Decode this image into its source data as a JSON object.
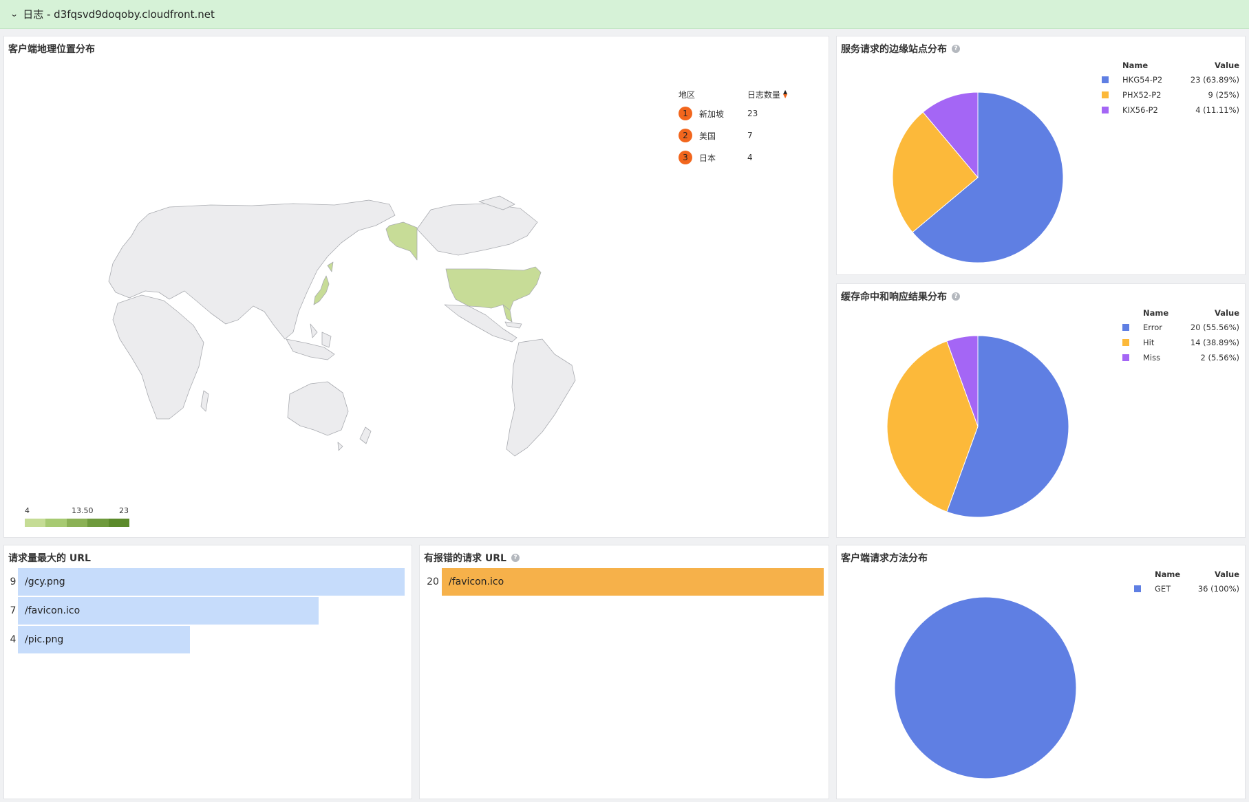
{
  "group": {
    "title": "日志 - d3fqsvd9doqoby.cloudfront.net"
  },
  "geo": {
    "title": "客户端地理位置分布",
    "table": {
      "col_region": "地区",
      "col_count": "日志数量",
      "rows": [
        {
          "rank": "1",
          "region": "新加坡",
          "count": "23"
        },
        {
          "rank": "2",
          "region": "美国",
          "count": "7"
        },
        {
          "rank": "3",
          "region": "日本",
          "count": "4"
        }
      ]
    },
    "scale": {
      "min": "4",
      "mid": "13.50",
      "max": "23",
      "colors": [
        "#c5dc95",
        "#a7ca72",
        "#8bb155",
        "#6e9a3c",
        "#5b8a2a"
      ]
    },
    "highlight_color": "#c7dc97"
  },
  "edge": {
    "title": "服务请求的边缘站点分布",
    "legend_name": "Name",
    "legend_value": "Value"
  },
  "cache": {
    "title": "缓存命中和响应结果分布",
    "legend_name": "Name",
    "legend_value": "Value"
  },
  "method": {
    "title": "客户端请求方法分布",
    "legend_name": "Name",
    "legend_value": "Value"
  },
  "top_urls": {
    "title": "请求量最大的 URL",
    "bar_color": "#c6dcfb",
    "rows": [
      {
        "count": "9",
        "url": "/gcy.png",
        "value": 9
      },
      {
        "count": "7",
        "url": "/favicon.ico",
        "value": 7
      },
      {
        "count": "4",
        "url": "/pic.png",
        "value": 4
      }
    ]
  },
  "error_urls": {
    "title": "有报错的请求 URL",
    "bar_color": "#f6b14a",
    "rows": [
      {
        "count": "20",
        "url": "/favicon.ico",
        "value": 20
      }
    ]
  },
  "chart_data": [
    {
      "type": "pie",
      "title": "服务请求的边缘站点分布",
      "categories": [
        "HKG54-P2",
        "PHX52-P2",
        "KIX56-P2"
      ],
      "values": [
        23,
        9,
        4
      ],
      "labels": [
        "23 (63.89%)",
        "9 (25%)",
        "4 (11.11%)"
      ],
      "colors": [
        "#5f7fe3",
        "#fcb93a",
        "#a466f5"
      ],
      "legend": "top-right"
    },
    {
      "type": "pie",
      "title": "缓存命中和响应结果分布",
      "categories": [
        "Error",
        "Hit",
        "Miss"
      ],
      "values": [
        20,
        14,
        2
      ],
      "labels": [
        "20 (55.56%)",
        "14 (38.89%)",
        "2 (5.56%)"
      ],
      "colors": [
        "#5f7fe3",
        "#fcb93a",
        "#a466f5"
      ],
      "legend": "top-right"
    },
    {
      "type": "pie",
      "title": "客户端请求方法分布",
      "categories": [
        "GET"
      ],
      "values": [
        36
      ],
      "labels": [
        "36 (100%)"
      ],
      "colors": [
        "#5f7fe3"
      ],
      "legend": "top-right"
    },
    {
      "type": "bar",
      "title": "请求量最大的 URL",
      "categories": [
        "/gcy.png",
        "/favicon.ico",
        "/pic.png"
      ],
      "values": [
        9,
        7,
        4
      ]
    },
    {
      "type": "bar",
      "title": "有报错的请求 URL",
      "categories": [
        "/favicon.ico"
      ],
      "values": [
        20
      ]
    }
  ]
}
